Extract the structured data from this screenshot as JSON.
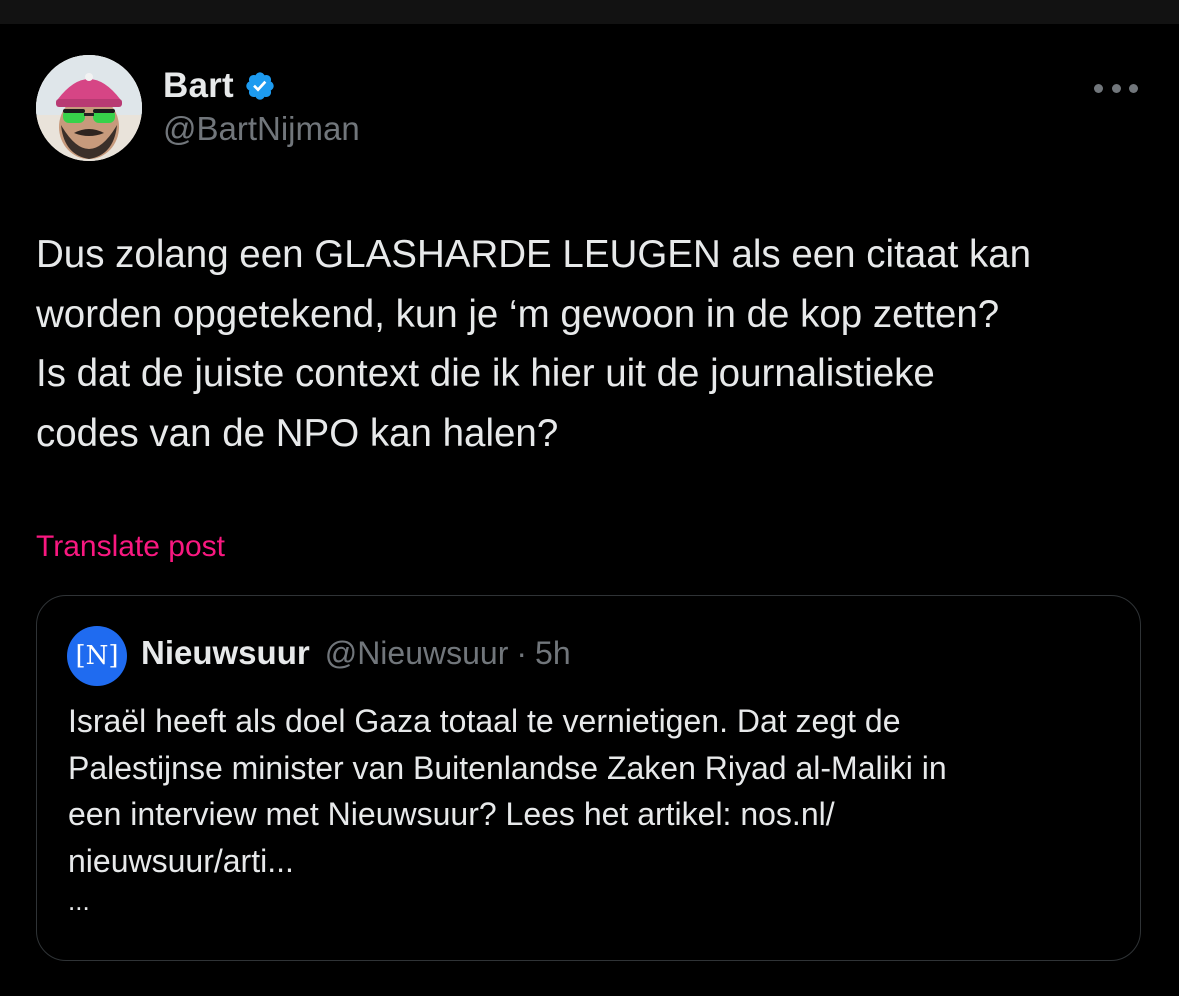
{
  "post": {
    "author": {
      "display_name": "Bart",
      "handle": "@BartNijman",
      "verified": true,
      "avatar": "avatar-photo"
    },
    "more_icon": "more-horizontal-icon",
    "text": "Dus zolang een GLASHARDE LEUGEN als een citaat kan\nworden opgetekend, kun je ‘m gewoon in de kop zetten?\nIs dat de juiste context die ik hier uit de journalistieke\ncodes van de NPO kan halen?",
    "translate_label": "Translate post",
    "quoted": {
      "avatar_glyph": "[N]",
      "display_name": "Nieuwsuur",
      "handle": "@Nieuwsuur",
      "separator": "·",
      "time": "5h",
      "text": "Israël heeft als doel Gaza totaal te vernietigen. Dat zegt de\nPalestijnse minister van Buitenlandse Zaken Riyad al-Maliki in\neen interview met Nieuwsuur? Lees het artikel: nos.nl/\nnieuwsuur/arti...",
      "ellipsis": "..."
    }
  },
  "colors": {
    "background": "#000000",
    "text": "#e7e9ea",
    "muted": "#71767b",
    "translate_link": "#f91880",
    "verified_badge": "#1d9bf0",
    "quote_avatar": "#1f6bf0",
    "border": "#2f3336"
  }
}
